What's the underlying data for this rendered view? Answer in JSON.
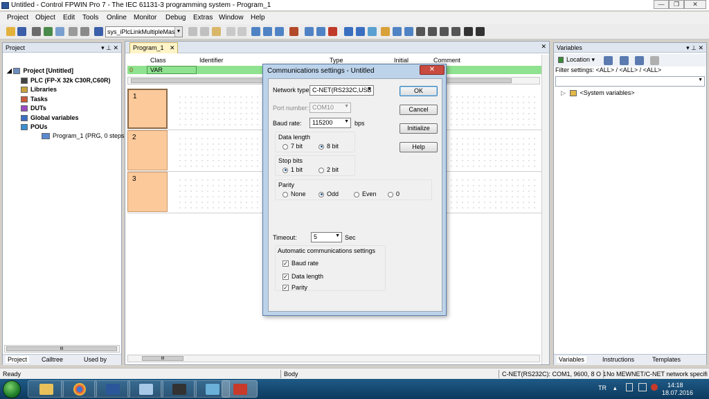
{
  "window": {
    "title": "Untitled - Control FPWIN Pro 7 - The IEC 61131-3 programming system - Program_1",
    "minimize": "—",
    "maximize": "❐",
    "close": "✕"
  },
  "menu": [
    "Project",
    "Object",
    "Edit",
    "Tools",
    "Online",
    "Monitor",
    "Debug",
    "Extras",
    "Window",
    "Help"
  ],
  "toolbar": {
    "combo_value": "sys_iPlcLinkMultipleMas"
  },
  "project_panel": {
    "title": "Project",
    "pin": "▾ ⊥ ✕",
    "tree": {
      "root": "Project [Untitled]",
      "plc": "PLC (FP-X 32k C30R,C60R)",
      "libraries": "Libraries",
      "tasks": "Tasks",
      "duts": "DUTs",
      "globals": "Global variables",
      "pous": "POUs",
      "program": "Program_1 (PRG, 0 steps)"
    },
    "tabs": [
      "Project",
      "Calltree",
      "Used by"
    ],
    "scroll_mark": "III"
  },
  "editor": {
    "tab": "Program_1",
    "tab_close": "✕",
    "close": "✕",
    "columns": [
      "Class",
      "Identifier",
      "Type",
      "Initial",
      "Comment"
    ],
    "row": {
      "num": "0",
      "class": "VAR"
    },
    "rungs": [
      "1",
      "2",
      "3"
    ],
    "scroll_mark": "III"
  },
  "variables_panel": {
    "title": "Variables",
    "pin": "▾ ⊥ ✕",
    "location": "Location",
    "filter": "Filter settings: <ALL> / <ALL> / <ALL>",
    "system": "<System variables>",
    "tabs": [
      "Variables",
      "Instructions",
      "Templates"
    ]
  },
  "status": {
    "ready": "Ready",
    "body": "Body",
    "connection": "C-NET(RS232C): COM1, 9600, 8 O 1",
    "network": "No MEWNET/C-NET network specifi"
  },
  "taskbar": {
    "lang": "TR",
    "time": "14:18",
    "date": "18.07.2016"
  },
  "dialog": {
    "title": "Communications settings - Untitled",
    "close": "✕",
    "network_type_label": "Network type:",
    "network_type": "C-NET(RS232C,USB",
    "port_label": "Port number:",
    "port": "COM10",
    "baud_label": "Baud rate:",
    "baud": "115200",
    "baud_unit": "bps",
    "data_length": {
      "label": "Data length",
      "opt1": "7 bit",
      "opt2": "8 bit"
    },
    "stop_bits": {
      "label": "Stop bits",
      "opt1": "1 bit",
      "opt2": "2 bit"
    },
    "parity": {
      "label": "Parity",
      "opt1": "None",
      "opt2": "Odd",
      "opt3": "Even",
      "opt4": "0"
    },
    "timeout_label": "Timeout:",
    "timeout": "5",
    "timeout_unit": "Sec",
    "auto_label": "Automatic communications settings",
    "auto": {
      "baud": "Baud rate",
      "data": "Data length",
      "parity": "Parity"
    },
    "buttons": {
      "ok": "OK",
      "cancel": "Cancel",
      "initialize": "Initialize",
      "help": "Help"
    }
  }
}
